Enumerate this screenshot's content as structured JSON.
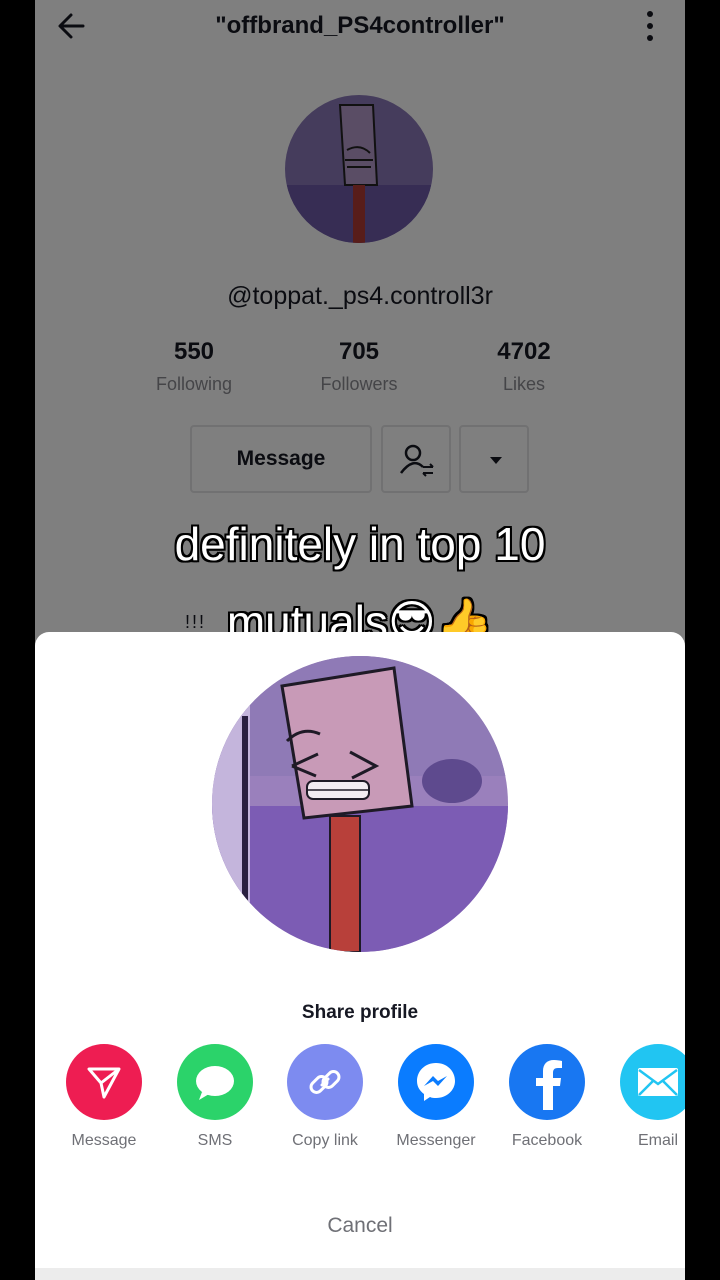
{
  "header": {
    "title": "\"offbrand_PS4controller\""
  },
  "profile": {
    "handle": "@toppat._ps4.controll3r",
    "stats": [
      {
        "value": "550",
        "label": "Following"
      },
      {
        "value": "705",
        "label": "Followers"
      },
      {
        "value": "4702",
        "label": "Likes"
      }
    ],
    "message_label": "Message",
    "bio_fragment": "!!!"
  },
  "caption": {
    "line1": "definitely in top 10",
    "line2": "mutuals😎👍"
  },
  "share_sheet": {
    "title": "Share profile",
    "options": [
      {
        "label": "Message",
        "icon": "send-icon",
        "color": "#ee1d52"
      },
      {
        "label": "SMS",
        "icon": "sms-bubble-icon",
        "color": "#2bd36a"
      },
      {
        "label": "Copy link",
        "icon": "link-icon",
        "color": "#7d8bf0"
      },
      {
        "label": "Messenger",
        "icon": "messenger-icon",
        "color": "#0a7cff"
      },
      {
        "label": "Facebook",
        "icon": "facebook-icon",
        "color": "#1877f2"
      },
      {
        "label": "Email",
        "icon": "email-icon",
        "color": "#21c5f2"
      }
    ],
    "cancel_label": "Cancel"
  }
}
